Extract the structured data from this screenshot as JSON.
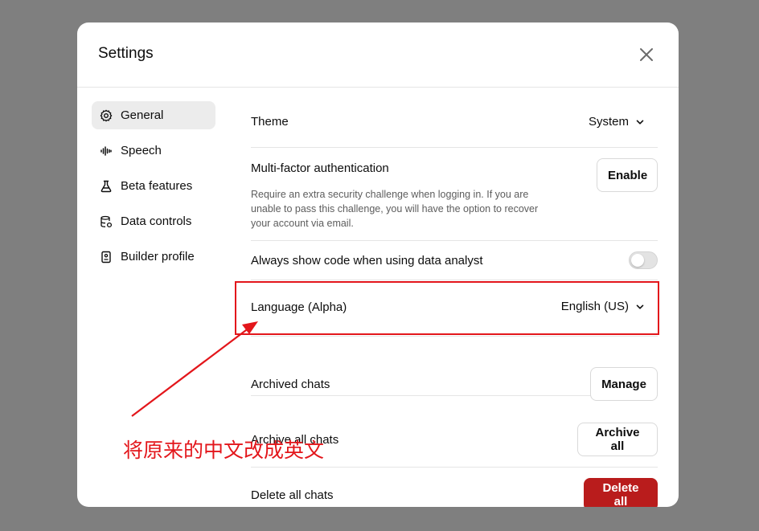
{
  "modal": {
    "title": "Settings",
    "close_icon": "close-icon"
  },
  "sidebar": {
    "items": [
      {
        "label": "General",
        "icon": "gear-icon",
        "active": true
      },
      {
        "label": "Speech",
        "icon": "waveform-icon",
        "active": false
      },
      {
        "label": "Beta features",
        "icon": "flask-icon",
        "active": false
      },
      {
        "label": "Data controls",
        "icon": "database-gear-icon",
        "active": false
      },
      {
        "label": "Builder profile",
        "icon": "id-badge-icon",
        "active": false
      }
    ]
  },
  "settings": {
    "theme": {
      "label": "Theme",
      "value": "System"
    },
    "mfa": {
      "label": "Multi-factor authentication",
      "description": "Require an extra security challenge when logging in. If you are unable to pass this challenge, you will have the option to recover your account via email.",
      "button": "Enable"
    },
    "code": {
      "label": "Always show code when using data analyst",
      "toggle_on": false
    },
    "language": {
      "label": "Language (Alpha)",
      "value": "English (US)"
    },
    "archived": {
      "label": "Archived chats",
      "button": "Manage"
    },
    "archive_all": {
      "label": "Archive all chats",
      "button": "Archive all"
    },
    "delete_all": {
      "label": "Delete all chats",
      "button": "Delete all"
    }
  },
  "annotation": {
    "text": "将原来的中文改成英文",
    "color": "#e3161b"
  },
  "colors": {
    "overlay": "#7f7f7f",
    "danger": "#b91c1c",
    "active_nav": "#ececec"
  }
}
